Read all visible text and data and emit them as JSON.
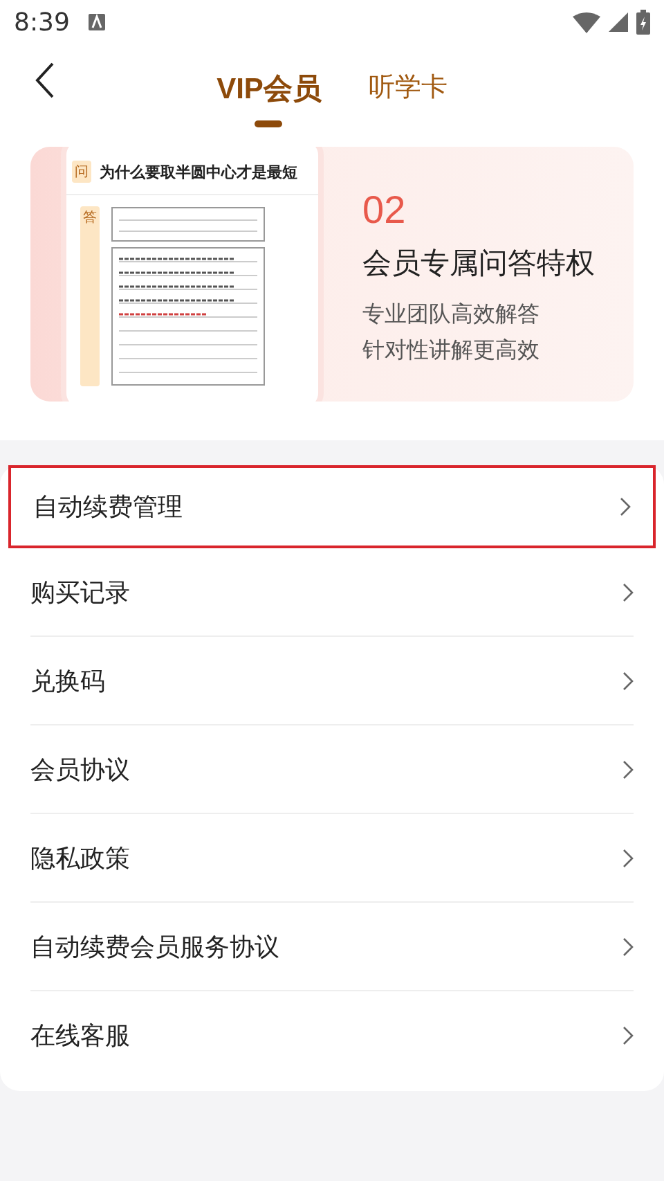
{
  "status_bar": {
    "time": "8:39"
  },
  "tabs": [
    {
      "label": "VIP会员",
      "selected": true
    },
    {
      "label": "听学卡",
      "selected": false
    }
  ],
  "banner": {
    "question_badge": "问",
    "question": "为什么要取半圆中心才是最短",
    "answer_badge": "答",
    "number": "02",
    "title": "会员专属问答特权",
    "lines": [
      "专业团队高效解答",
      "针对性讲解更高效"
    ]
  },
  "menu": [
    {
      "label": "自动续费管理",
      "highlighted": true
    },
    {
      "label": "购买记录",
      "highlighted": false
    },
    {
      "label": "兑换码",
      "highlighted": false
    },
    {
      "label": "会员协议",
      "highlighted": false
    },
    {
      "label": "隐私政策",
      "highlighted": false
    },
    {
      "label": "自动续费会员服务协议",
      "highlighted": false
    },
    {
      "label": "在线客服",
      "highlighted": false
    }
  ]
}
